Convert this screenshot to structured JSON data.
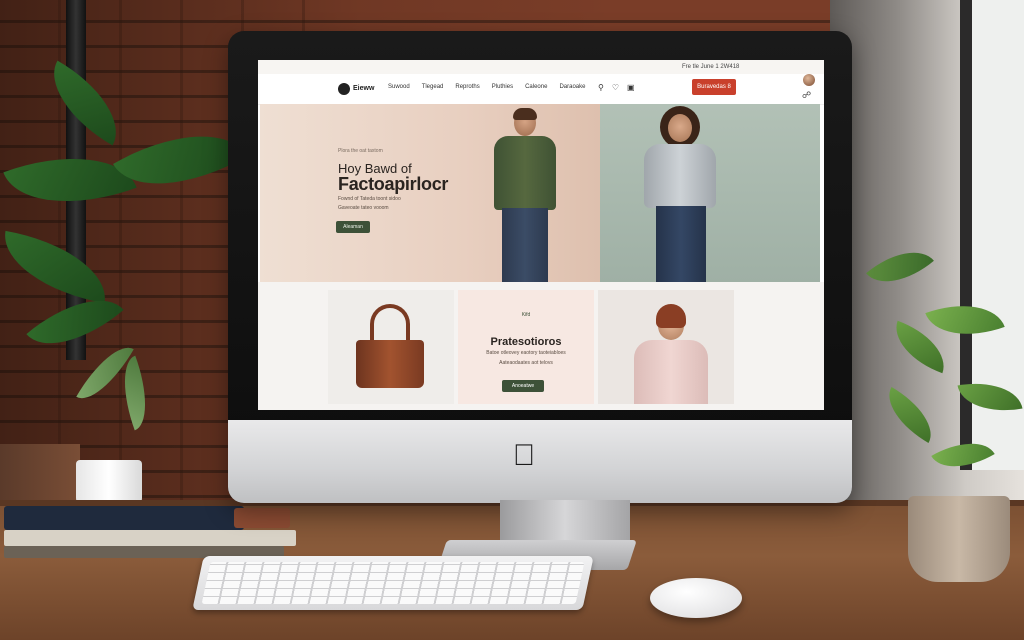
{
  "screen": {
    "topbar": {
      "left_text": "",
      "mid_text": "",
      "right_text": "Fre tle June 1 2W418"
    },
    "nav": {
      "logo": "Eieww",
      "items": [
        "Suwood",
        "Tlegead",
        "Reproths",
        "Pluthies",
        "Caleone",
        "Daraoake"
      ],
      "cta": "Buravedas 8"
    },
    "hero": {
      "kicker": "Plora the oat taxtom",
      "title_line1": "Hoy Bawd of",
      "title_line2": "Factoapirlocr",
      "sub_line1": "Fownd of Tateda toont sidoo",
      "sub_line2": "Gaveoate tateo vooom",
      "button": "Aleaman"
    },
    "promo": {
      "tag": "Kifd",
      "title": "Pratesotioros",
      "sub_line1": "Batoe otleovey eaotory taoteiabloes",
      "sub_line2": "Aateaodaates aot telovs",
      "button": "Anoeatwe"
    }
  },
  "colors": {
    "cta": "#c9402c",
    "hero_button": "#3d5138",
    "hero_left_bg": "#e8cfc0",
    "hero_right_bg": "#a9b9ae",
    "promo_bg": "#f7e8e2"
  },
  "icons": {
    "brand": "apple-logo-icon"
  }
}
